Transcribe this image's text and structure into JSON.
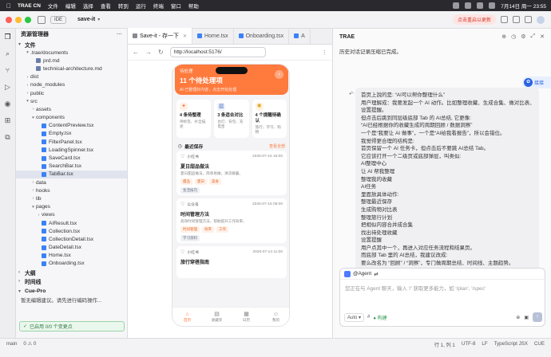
{
  "menubar": {
    "app": "TRAE CN",
    "items": [
      "文件",
      "编辑",
      "选择",
      "查看",
      "转到",
      "运行",
      "终端",
      "窗口",
      "帮助"
    ],
    "clock": "7月14日 周一 23:55"
  },
  "titlebar": {
    "ide_label": "IDE",
    "project": "save-it",
    "update_label": "点击重启以更新"
  },
  "explorer": {
    "title": "资源管理器",
    "section_files": "文件",
    "tree": [
      {
        "label": ".trae/documents",
        "depth": 1,
        "kind": "folder",
        "open": true
      },
      {
        "label": "prd.md",
        "depth": 2,
        "kind": "md"
      },
      {
        "label": "technical-architecture.md",
        "depth": 2,
        "kind": "md"
      },
      {
        "label": "dist",
        "depth": 1,
        "kind": "folder",
        "open": false
      },
      {
        "label": "node_modules",
        "depth": 1,
        "kind": "folder",
        "open": false
      },
      {
        "label": "public",
        "depth": 1,
        "kind": "folder",
        "open": false
      },
      {
        "label": "src",
        "depth": 1,
        "kind": "folder",
        "open": true
      },
      {
        "label": "assets",
        "depth": 2,
        "kind": "folder",
        "open": false
      },
      {
        "label": "components",
        "depth": 2,
        "kind": "folder",
        "open": true
      },
      {
        "label": "ContentPreview.tsx",
        "depth": 3,
        "kind": "ts"
      },
      {
        "label": "Empty.tsx",
        "depth": 3,
        "kind": "ts"
      },
      {
        "label": "FilterPanel.tsx",
        "depth": 3,
        "kind": "ts"
      },
      {
        "label": "LoadingSpinner.tsx",
        "depth": 3,
        "kind": "ts"
      },
      {
        "label": "SaveCard.tsx",
        "depth": 3,
        "kind": "ts"
      },
      {
        "label": "SearchBar.tsx",
        "depth": 3,
        "kind": "ts"
      },
      {
        "label": "TabBar.tsx",
        "depth": 3,
        "kind": "ts",
        "selected": true
      },
      {
        "label": "data",
        "depth": 2,
        "kind": "folder",
        "open": false
      },
      {
        "label": "hooks",
        "depth": 2,
        "kind": "folder",
        "open": false
      },
      {
        "label": "lib",
        "depth": 2,
        "kind": "folder",
        "open": false
      },
      {
        "label": "pages",
        "depth": 2,
        "kind": "folder",
        "open": true
      },
      {
        "label": "views",
        "depth": 3,
        "kind": "folder",
        "open": false
      },
      {
        "label": "AIResult.tsx",
        "depth": 3,
        "kind": "ts"
      },
      {
        "label": "Collection.tsx",
        "depth": 3,
        "kind": "ts"
      },
      {
        "label": "CollectionDetail.tsx",
        "depth": 3,
        "kind": "ts"
      },
      {
        "label": "DateDetail.tsx",
        "depth": 3,
        "kind": "ts"
      },
      {
        "label": "Home.tsx",
        "depth": 3,
        "kind": "ts"
      },
      {
        "label": "Onboarding.tsx",
        "depth": 3,
        "kind": "ts"
      }
    ],
    "section_outline": "大纲",
    "section_timeline": "时间线",
    "section_cue": "Cue-Pro",
    "cue_message": "暂无编辑建议。请先进行编码操作...",
    "cue_status": "已启用 0/0 个变更点"
  },
  "editor": {
    "tabs": [
      {
        "label": "Save-it - 存一下",
        "active": true
      },
      {
        "label": "Home.tsx",
        "active": false
      },
      {
        "label": "Onboarding.tsx",
        "active": false
      },
      {
        "label": "A",
        "active": false
      }
    ],
    "url": "http://localhost:5176/"
  },
  "phone": {
    "banner_small": "待处理",
    "banner_title": "11 个待处理项",
    "banner_desc": "AI 已整理好内容，点击开始处理",
    "cards": [
      {
        "title": "4 条待整理",
        "sub": "待标签、补全描述",
        "color": "#fff1e8",
        "fg": "#ff7a3d",
        "icon": "sparkle-icon"
      },
      {
        "title": "3 条适合对比",
        "sub": "台灯、背包、充电宝",
        "color": "#eef2fb",
        "fg": "#4d6fbf",
        "icon": "chart-icon"
      },
      {
        "title": "4 个提醒待确认",
        "sub": "旅行、学习、购物",
        "color": "#fff5e0",
        "fg": "#e0a020",
        "icon": "bulb-icon"
      }
    ],
    "recent_title": "最近保存",
    "recent_all": "查看全部",
    "items": [
      {
        "source": "小红书",
        "date": "2026-07-16 16:00",
        "title": "夏日甜品做法",
        "desc": "夏日甜品做法，简单易做，清凉解暑。",
        "tags": [
          "甜品",
          "夏日",
          "美食"
        ],
        "group": "生活技巧"
      },
      {
        "source": "公众号",
        "date": "2026-07-15 08:00",
        "title": "时间管理方法",
        "desc": "高效时间管理方法，帮助提升工作效率。",
        "tags": [
          "时间管理",
          "效率",
          "工作"
        ],
        "group": "学习资料"
      },
      {
        "source": "小红书",
        "date": "2026-07-14 11:00",
        "title": "旅行穿搭指南",
        "desc": "",
        "tags": [],
        "group": ""
      }
    ],
    "tabbar": [
      {
        "label": "首页",
        "icon": "home-icon",
        "active": true
      },
      {
        "label": "收藏夹",
        "icon": "folder-icon",
        "active": false
      },
      {
        "label": "日历",
        "icon": "calendar-icon",
        "active": false
      },
      {
        "label": "我的",
        "icon": "user-icon",
        "active": false
      }
    ]
  },
  "panel": {
    "title": "TRAE",
    "history_note": "历史对话记录压缩已完成。",
    "float_label": "接接",
    "message_lines": [
      "首页上說的是: “AI可以帮你整理什么”",
      "用户理解成：我要发起一个 AI 动作。比如整理收藏、生成合集、做对比表、",
      "设置提醒。",
      "但点击后跳到同层级底部 Tab 的 AI总结, 它更像:",
      "“AI已经根据你的收藏生成的周期回顾 / 数据洞察”",
      "一个是“我要让 AI 做事”，一个是“AI给我看报告”，所以会错位。",
      "我觉得更合理的结构是:",
      "首页保留一个 AI 任务卡，但点击后不要跳 AI总结 Tab。",
      "它应该打开一个二级页或底部弹层，叫类似:",
      "AI整理中心",
      "让 AI 帮我整理",
      "整理我的收藏",
      "AI任务",
      "里面放具体动作:",
      "整理最近保存",
      "生成购物对比表",
      "整理旅行计划",
      "把相似内容合并成合集",
      "找出待处理收藏",
      "设置提醒",
      "用户点其中一个，再进入对应任务流程和结果页。",
      "而底部 Tab 里的 AI总结，我建议改成:",
      "要么改名为 “回顾” / “洞察”，专门做周期总结、时间线、主题趋势。"
    ],
    "agent_label": "@Agent",
    "placeholder": "您正在与 Agent 聊天，输入 '/' 获取更多能力，如 '/plan', '/spec'",
    "auto_label": "Auto",
    "mode_label": "构建"
  },
  "statusbar": {
    "left": [
      "main",
      "0 ⚠ 0"
    ],
    "right": [
      "行 1, 列 1",
      "UTF-8",
      "LF",
      "TypeScript JSX",
      "CUE"
    ]
  }
}
